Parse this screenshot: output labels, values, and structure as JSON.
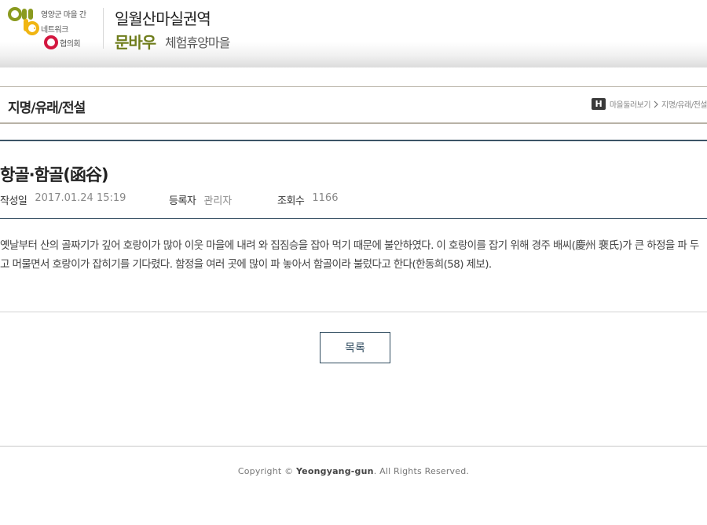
{
  "header": {
    "logo_line1": "영양군 마을 간",
    "logo_line2": "네트워크",
    "logo_line3": "협의회",
    "site_title": "일월산마실권역",
    "brand_name": "문바우",
    "brand_sub": "체험휴양마을",
    "logo_colors": {
      "green": "#8a9a1f",
      "yellow": "#f0b512",
      "red": "#d3173f"
    }
  },
  "page": {
    "title": "지명/유래/전설",
    "breadcrumb": {
      "home_icon": "H",
      "items": [
        "마을둘러보기",
        "지명/유래/전설"
      ]
    }
  },
  "article": {
    "title": "항골·함골(函谷)",
    "meta": {
      "date_label": "작성일",
      "date_value": "2017.01.24 15:19",
      "author_label": "등록자",
      "author_value": "관리자",
      "views_label": "조회수",
      "views_value": "1166"
    },
    "body": "옛날부터 산의 골짜기가 깊어 호랑이가 많아 이웃 마을에 내려 와 집짐승을 잡아 먹기 때문에 불안하였다. 이 호랑이를 잡기 위해 경주 배씨(慶州 裵氏)가 큰 하정을 파 두고 머물면서 호랑이가 잡히기를 기다렸다. 함정을 여러 곳에 많이 파 놓아서 함골이라 불렀다고 한다(한동희(58) 제보).",
    "list_button": "목록"
  },
  "footer": {
    "copyright_prefix": "Copyright ©",
    "copyright_name": "Yeongyang-gun",
    "copyright_suffix": ". All Rights Reserved."
  },
  "colors": {
    "accent_navy": "#2f4b5f",
    "brand_olive": "#6f7d1c"
  }
}
